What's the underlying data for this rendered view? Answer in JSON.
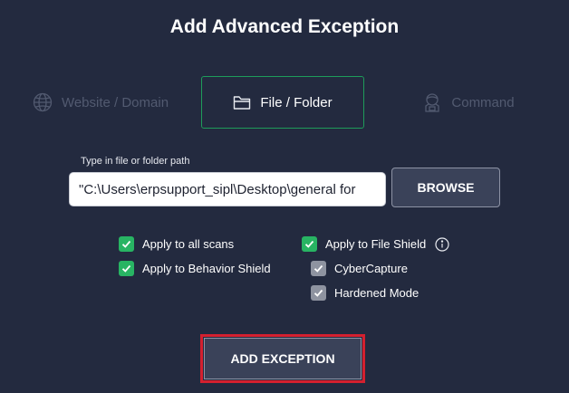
{
  "dialog": {
    "title": "Add Advanced Exception"
  },
  "tabs": [
    {
      "label": "Website / Domain",
      "icon": "globe-icon",
      "state": "disabled"
    },
    {
      "label": "File / Folder",
      "icon": "folder-icon",
      "state": "selected"
    },
    {
      "label": "Command",
      "icon": "command-icon",
      "state": "disabled"
    }
  ],
  "path": {
    "label": "Type in file or folder path",
    "value": "\"C:\\Users\\erpsupport_sipl\\Desktop\\general for"
  },
  "browse_button": {
    "label": "BROWSE"
  },
  "options": {
    "apply_all_scans": {
      "label": "Apply to all scans",
      "checked": true
    },
    "apply_behavior_shield": {
      "label": "Apply to Behavior Shield",
      "checked": true
    },
    "apply_file_shield": {
      "label": "Apply to File Shield",
      "checked": true,
      "info_icon": "info-icon"
    },
    "cybercapture": {
      "label": "CyberCapture",
      "checked": true
    },
    "hardened_mode": {
      "label": "Hardened Mode",
      "checked": true
    }
  },
  "add_exception_button": {
    "label": "ADD EXCEPTION"
  },
  "colors": {
    "background": "#232a3f",
    "accent_green": "#28b463",
    "selected_tab_border": "#1e9c5a",
    "highlight_red": "#d4202f",
    "button_bg": "#3a4259"
  }
}
